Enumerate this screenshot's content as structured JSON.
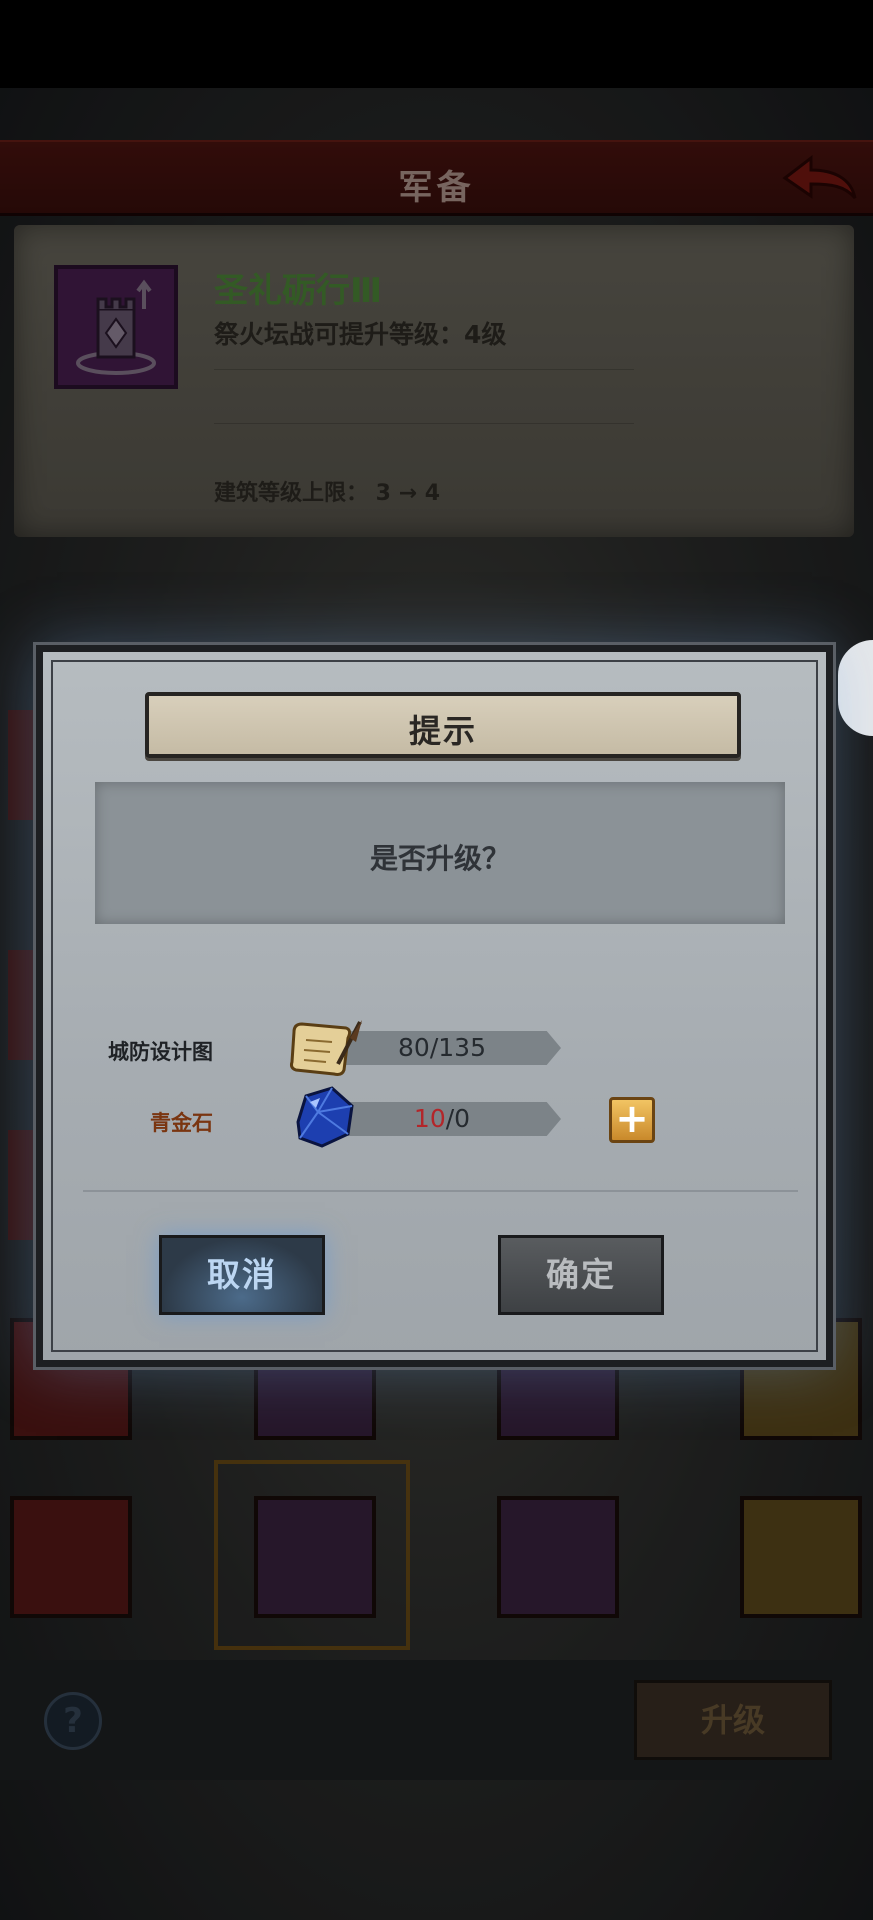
{
  "header": {
    "title": "军备"
  },
  "info_panel": {
    "title": "圣礼砺行Ⅲ",
    "description": "祭火坛战可提升等级：4级",
    "limit_text": "建筑等级上限： 3 → 4"
  },
  "dialog": {
    "title": "提示",
    "message": "是否升级？",
    "resources": [
      {
        "label": "城防设计图",
        "have": "80",
        "need": "135",
        "icon": "blueprint-scroll-icon"
      },
      {
        "label": "青金石",
        "have": "10",
        "need": "0",
        "icon": "lapis-gem-icon"
      }
    ],
    "separator": "/",
    "plus_label": "+",
    "cancel_label": "取消",
    "confirm_label": "确定"
  },
  "bottom": {
    "upgrade_label": "升级",
    "help_label": "?"
  },
  "colors": {
    "accent_blue": "#bcd6f2",
    "title_green": "#4f8a3a",
    "warning_red": "#b3262a",
    "header_red": "#4d1410"
  }
}
